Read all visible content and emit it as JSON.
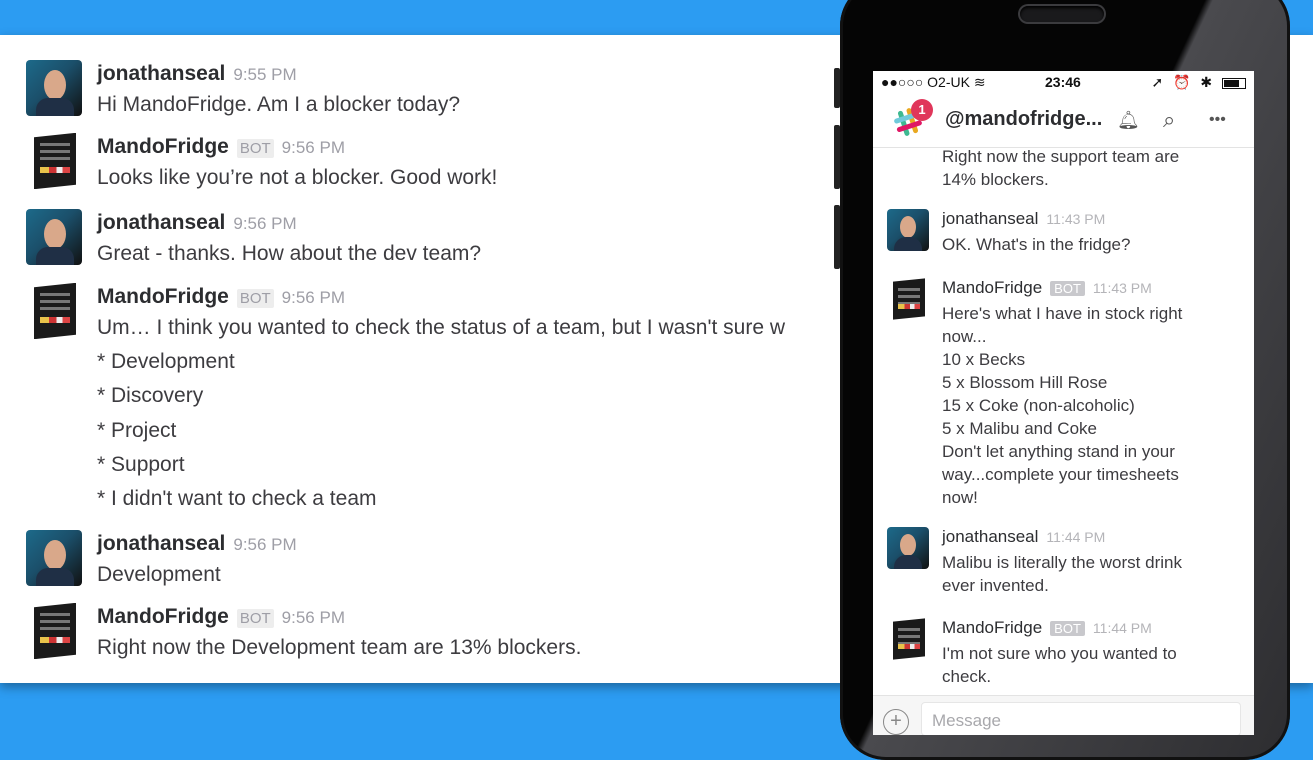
{
  "desktop": {
    "messages": [
      {
        "user": "jonathanseal",
        "bot": false,
        "time": "9:55 PM",
        "lines": [
          "Hi MandoFridge. Am I a blocker today?"
        ]
      },
      {
        "user": "MandoFridge",
        "bot": true,
        "bot_label": "BOT",
        "time": "9:56 PM",
        "lines": [
          "Looks like you’re not a blocker. Good work!"
        ]
      },
      {
        "user": "jonathanseal",
        "bot": false,
        "time": "9:56 PM",
        "lines": [
          "Great - thanks. How about the dev team?"
        ]
      },
      {
        "user": "MandoFridge",
        "bot": true,
        "bot_label": "BOT",
        "time": "9:56 PM",
        "lines": [
          "Um… I think you wanted to check the status of a team, but I wasn't sure w",
          "* Development",
          "* Discovery",
          "* Project",
          "* Support",
          "* I didn't want to check a team"
        ]
      },
      {
        "user": "jonathanseal",
        "bot": false,
        "time": "9:56 PM",
        "lines": [
          "Development"
        ]
      },
      {
        "user": "MandoFridge",
        "bot": true,
        "bot_label": "BOT",
        "time": "9:56 PM",
        "lines": [
          "Right now the Development team are 13% blockers."
        ]
      }
    ]
  },
  "phone": {
    "status_bar": {
      "carrier": "●●○○○ O2-UK",
      "wifi": "wifi-icon",
      "time": "23:46",
      "right_icons": "➚ ⏰ ✱"
    },
    "nav": {
      "title": "@mandofridge...",
      "badge_count": "1",
      "snooze_icon": "🔕",
      "search_icon": "⌕",
      "more_icon": "•••"
    },
    "partial_message": {
      "lines": [
        "Right now the support team are",
        "14% blockers."
      ]
    },
    "messages": [
      {
        "user": "jonathanseal",
        "bot": false,
        "time": "11:43 PM",
        "lines": [
          "OK. What's in the fridge?"
        ]
      },
      {
        "user": "MandoFridge",
        "bot": true,
        "bot_label": "BOT",
        "time": "11:43 PM",
        "lines": [
          "Here's what I have in stock right",
          "now...",
          "10 x Becks",
          "5 x Blossom Hill Rose",
          "15 x Coke (non-alcoholic)",
          "5 x Malibu and Coke",
          "Don't let anything stand in your",
          "way...complete your timesheets",
          "now!"
        ]
      },
      {
        "user": "jonathanseal",
        "bot": false,
        "time": "11:44 PM",
        "lines": [
          "Malibu is literally the worst drink",
          "ever invented."
        ]
      },
      {
        "user": "MandoFridge",
        "bot": true,
        "bot_label": "BOT",
        "time": "11:44 PM",
        "lines": [
          "I'm not sure who you wanted to",
          "check."
        ]
      }
    ],
    "composer": {
      "placeholder": "Message",
      "add_label": "+"
    }
  },
  "colors": {
    "background": "#2c9cf2",
    "badge": "#e0365a"
  }
}
